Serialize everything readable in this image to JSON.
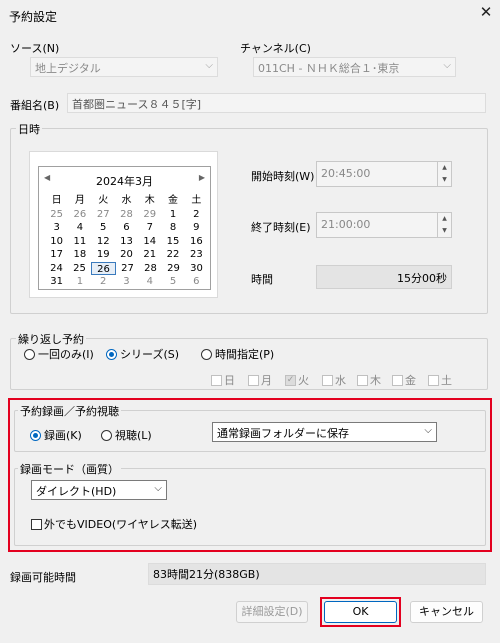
{
  "window": {
    "title": "予約設定",
    "close_glyph": "✕"
  },
  "source": {
    "label": "ソース(N)",
    "value": "地上デジタル"
  },
  "channel": {
    "label": "チャンネル(C)",
    "value": "011CH - ＮＨＫ総合１･東京"
  },
  "program": {
    "label": "番組名(B)",
    "value": "首都圏ニュース８４５[字]"
  },
  "datetime": {
    "group_label": "日時",
    "calendar": {
      "month_label": "2024年3月",
      "prev_glyph": "◀",
      "next_glyph": "▶",
      "weekdays": [
        "日",
        "月",
        "火",
        "水",
        "木",
        "金",
        "土"
      ],
      "weeks": [
        [
          "25",
          "26",
          "27",
          "28",
          "29",
          "1",
          "2"
        ],
        [
          "3",
          "4",
          "5",
          "6",
          "7",
          "8",
          "9"
        ],
        [
          "10",
          "11",
          "12",
          "13",
          "14",
          "15",
          "16"
        ],
        [
          "17",
          "18",
          "19",
          "20",
          "21",
          "22",
          "23"
        ],
        [
          "24",
          "25",
          "26",
          "27",
          "28",
          "29",
          "30"
        ],
        [
          "31",
          "1",
          "2",
          "3",
          "4",
          "5",
          "6"
        ]
      ],
      "selected_day": "26"
    },
    "start": {
      "label": "開始時刻(W)",
      "value": "20:45:00"
    },
    "end": {
      "label": "終了時刻(E)",
      "value": "21:00:00"
    },
    "duration": {
      "label": "時間",
      "value": "15分00秒"
    }
  },
  "repeat": {
    "group_label": "繰り返し予約",
    "options": [
      {
        "label": "一回のみ(I)",
        "selected": false
      },
      {
        "label": "シリーズ(S)",
        "selected": true
      },
      {
        "label": "時間指定(P)",
        "selected": false
      }
    ],
    "days": [
      {
        "label": "日",
        "checked": false
      },
      {
        "label": "月",
        "checked": false
      },
      {
        "label": "火",
        "checked": true
      },
      {
        "label": "水",
        "checked": false
      },
      {
        "label": "木",
        "checked": false
      },
      {
        "label": "金",
        "checked": false
      },
      {
        "label": "土",
        "checked": false
      }
    ]
  },
  "recording": {
    "group_label": "予約録画／予約視聴",
    "options": [
      {
        "label": "録画(K)",
        "selected": true
      },
      {
        "label": "視聴(L)",
        "selected": false
      }
    ],
    "folder": "通常録画フォルダーに保存",
    "mode": {
      "group_label": "録画モード（画質）",
      "value": "ダイレクト(HD)",
      "outside_video": {
        "label": "外でもVIDEO(ワイヤレス転送)",
        "checked": false
      }
    }
  },
  "available": {
    "label": "録画可能時間",
    "value": "83時間21分(838GB)"
  },
  "buttons": {
    "detail": "詳細設定(D)",
    "ok": "OK",
    "cancel": "キャンセル"
  },
  "colors": {
    "accent": "#0067c0",
    "highlight_box": "#e3001f"
  }
}
